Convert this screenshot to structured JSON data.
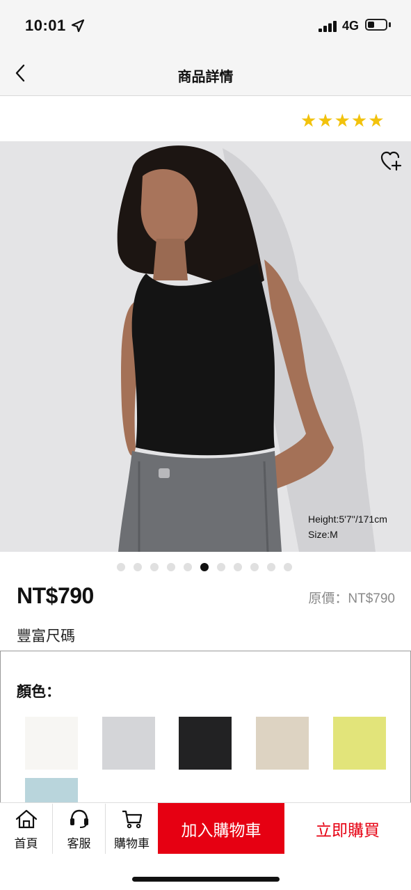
{
  "status_bar": {
    "time": "10:01",
    "network": "4G"
  },
  "header": {
    "title": "商品詳情"
  },
  "product": {
    "rating_stars": "★★★★★",
    "rating": 5,
    "model_height": "Height:5'7''/171cm",
    "model_size": "Size:M",
    "price": "NT$790",
    "original_price": "原價：NT$790",
    "size_note": "豐富尺碼",
    "carousel": {
      "total": 11,
      "active_index": 5
    }
  },
  "colors": {
    "label": "顏色：",
    "swatches": [
      {
        "name": "white",
        "hex": "#f7f6f3"
      },
      {
        "name": "light-gray",
        "hex": "#d4d5d8"
      },
      {
        "name": "black",
        "hex": "#222223"
      },
      {
        "name": "beige",
        "hex": "#ddd3c2"
      },
      {
        "name": "yellow",
        "hex": "#e2e47a"
      },
      {
        "name": "light-blue",
        "hex": "#b9d5dc"
      }
    ]
  },
  "bottom_nav": {
    "home": "首頁",
    "service": "客服",
    "cart": "購物車",
    "add_to_cart": "加入購物車",
    "buy_now": "立即購買"
  },
  "theme": {
    "accent": "#e60012",
    "star": "#f2c20c"
  }
}
